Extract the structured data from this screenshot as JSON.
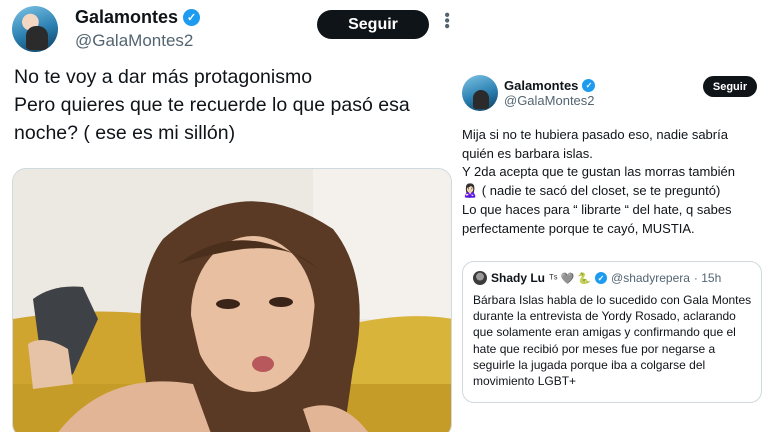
{
  "left_tweet": {
    "display_name": "Galamontes",
    "handle": "@GalaMontes2",
    "follow_label": "Seguir",
    "more_icon": "more-vertical-icon",
    "text_lines": [
      "No te voy a dar más protagonismo",
      "Pero quieres que te recuerde lo que pasó esa",
      "noche? ( ese es mi sillón)"
    ]
  },
  "right_tweet": {
    "display_name": "Galamontes",
    "handle": "@GalaMontes2",
    "follow_label": "Seguir",
    "text_lines": [
      "Mija si no te hubiera pasado eso, nadie sabría",
      "quién es barbara islas.",
      "Y 2da  acepta  que te gustan las morras también",
      "🙎🏻‍♀️ ( nadie te sacó del closet, se te preguntó)",
      "Lo que haces para “ librarte  “ del hate, q sabes",
      "perfectamente  porque te cayó, MUSTIA."
    ],
    "quote": {
      "name": "Shady Lu",
      "name_emojis": "ᵀˢ 🩶 🐍",
      "handle": "@shadyrepera",
      "time": "· 15h",
      "text_lines": [
        "Bárbara Islas habla de lo sucedido con Gala Montes",
        "durante la entrevista de Yordy Rosado, aclarando",
        "que solamente eran amigas y confirmando que el",
        "hate que recibió por meses fue por negarse a",
        "seguirle la jugada porque iba a colgarse del",
        "movimiento LGBT+"
      ]
    }
  },
  "colors": {
    "verified": "#1d9bf0",
    "button_bg": "#0f1419",
    "handle": "#536471",
    "sofa": "#d8b43a"
  }
}
